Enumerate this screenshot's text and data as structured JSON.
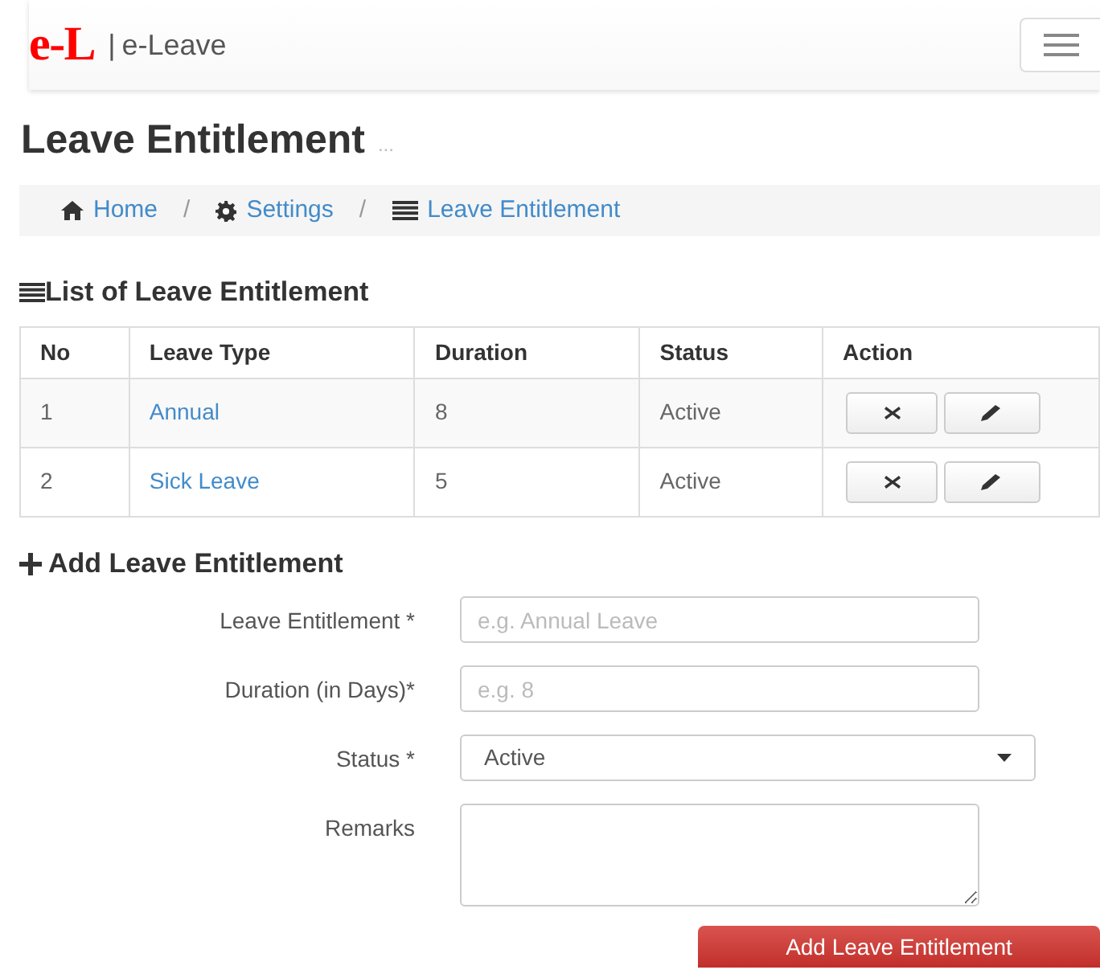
{
  "navbar": {
    "logo": "e-L",
    "separator": "|",
    "brand": "e-Leave"
  },
  "page_title": "Leave Entitlement",
  "page_title_suffix": "...",
  "breadcrumb": [
    {
      "label": "Home"
    },
    {
      "label": "Settings"
    },
    {
      "label": "Leave Entitlement"
    }
  ],
  "breadcrumb_separator": "/",
  "list_heading": "List of Leave Entitlement",
  "table": {
    "columns": [
      "No",
      "Leave Type",
      "Duration",
      "Status",
      "Action"
    ],
    "rows": [
      {
        "no": "1",
        "leave_type": "Annual",
        "duration": "8",
        "status": "Active"
      },
      {
        "no": "2",
        "leave_type": "Sick Leave",
        "duration": "5",
        "status": "Active"
      }
    ]
  },
  "form": {
    "heading": "Add Leave Entitlement",
    "fields": [
      {
        "kind": "text",
        "label": "Leave Entitlement *",
        "placeholder": "e.g. Annual Leave"
      },
      {
        "kind": "text",
        "label": "Duration (in Days)*",
        "placeholder": "e.g. 8"
      },
      {
        "kind": "select",
        "label": "Status *",
        "value": "Active"
      },
      {
        "kind": "textarea",
        "label": "Remarks"
      }
    ],
    "submit": "Add Leave Entitlement"
  }
}
